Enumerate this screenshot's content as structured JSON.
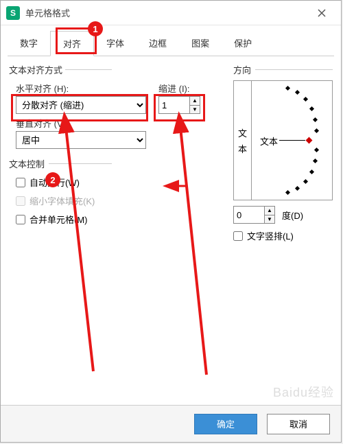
{
  "dialog": {
    "title": "单元格格式"
  },
  "tabs": [
    "数字",
    "对齐",
    "字体",
    "边框",
    "图案",
    "保护"
  ],
  "active_tab_index": 1,
  "text_align": {
    "section_label": "文本对齐方式",
    "horizontal_label": "水平对齐 (H):",
    "horizontal_value": "分散对齐 (缩进)",
    "indent_label": "缩进 (I):",
    "indent_value": "1",
    "vertical_label": "垂直对齐 (V):",
    "vertical_value": "居中"
  },
  "text_control": {
    "section_label": "文本控制",
    "wrap": "自动换行(W)",
    "shrink": "缩小字体填充(K)",
    "merge": "合并单元格(M)"
  },
  "direction": {
    "section_label": "方向",
    "vertical_text_chars": [
      "文",
      "本"
    ],
    "sample_text": "文本",
    "degree_value": "0",
    "degree_label": "度(D)",
    "vertical_layout": "文字竖排(L)"
  },
  "buttons": {
    "ok": "确定",
    "cancel": "取消"
  },
  "annotations": {
    "badge1": "1",
    "badge2": "2"
  },
  "watermark": "Baidu经验"
}
